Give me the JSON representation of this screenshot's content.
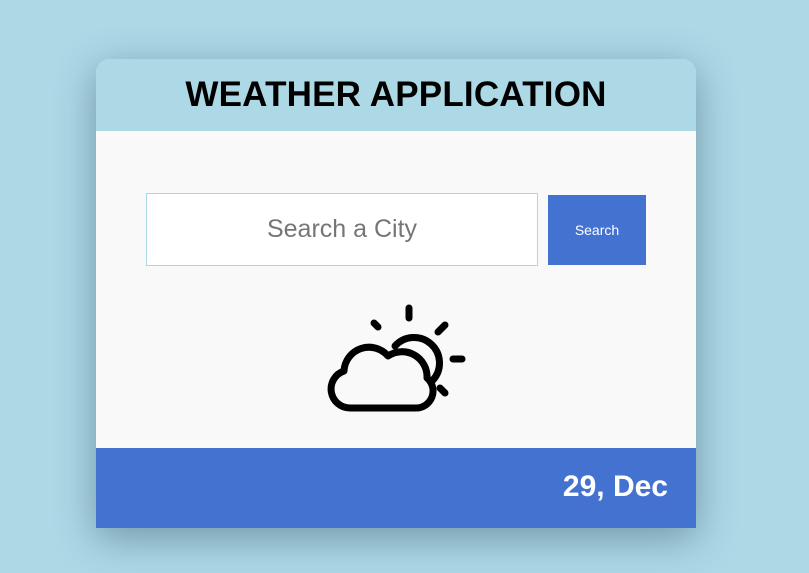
{
  "header": {
    "title": "WEATHER APPLICATION"
  },
  "search": {
    "placeholder": "Search a City",
    "value": "",
    "button_label": "Search"
  },
  "weather": {
    "icon": "partly-cloudy-icon"
  },
  "footer": {
    "date": "29, Dec"
  },
  "colors": {
    "page_background": "#add8e6",
    "header_background": "#add8e6",
    "accent": "#4472d1",
    "card_background": "#f9f9f9"
  }
}
